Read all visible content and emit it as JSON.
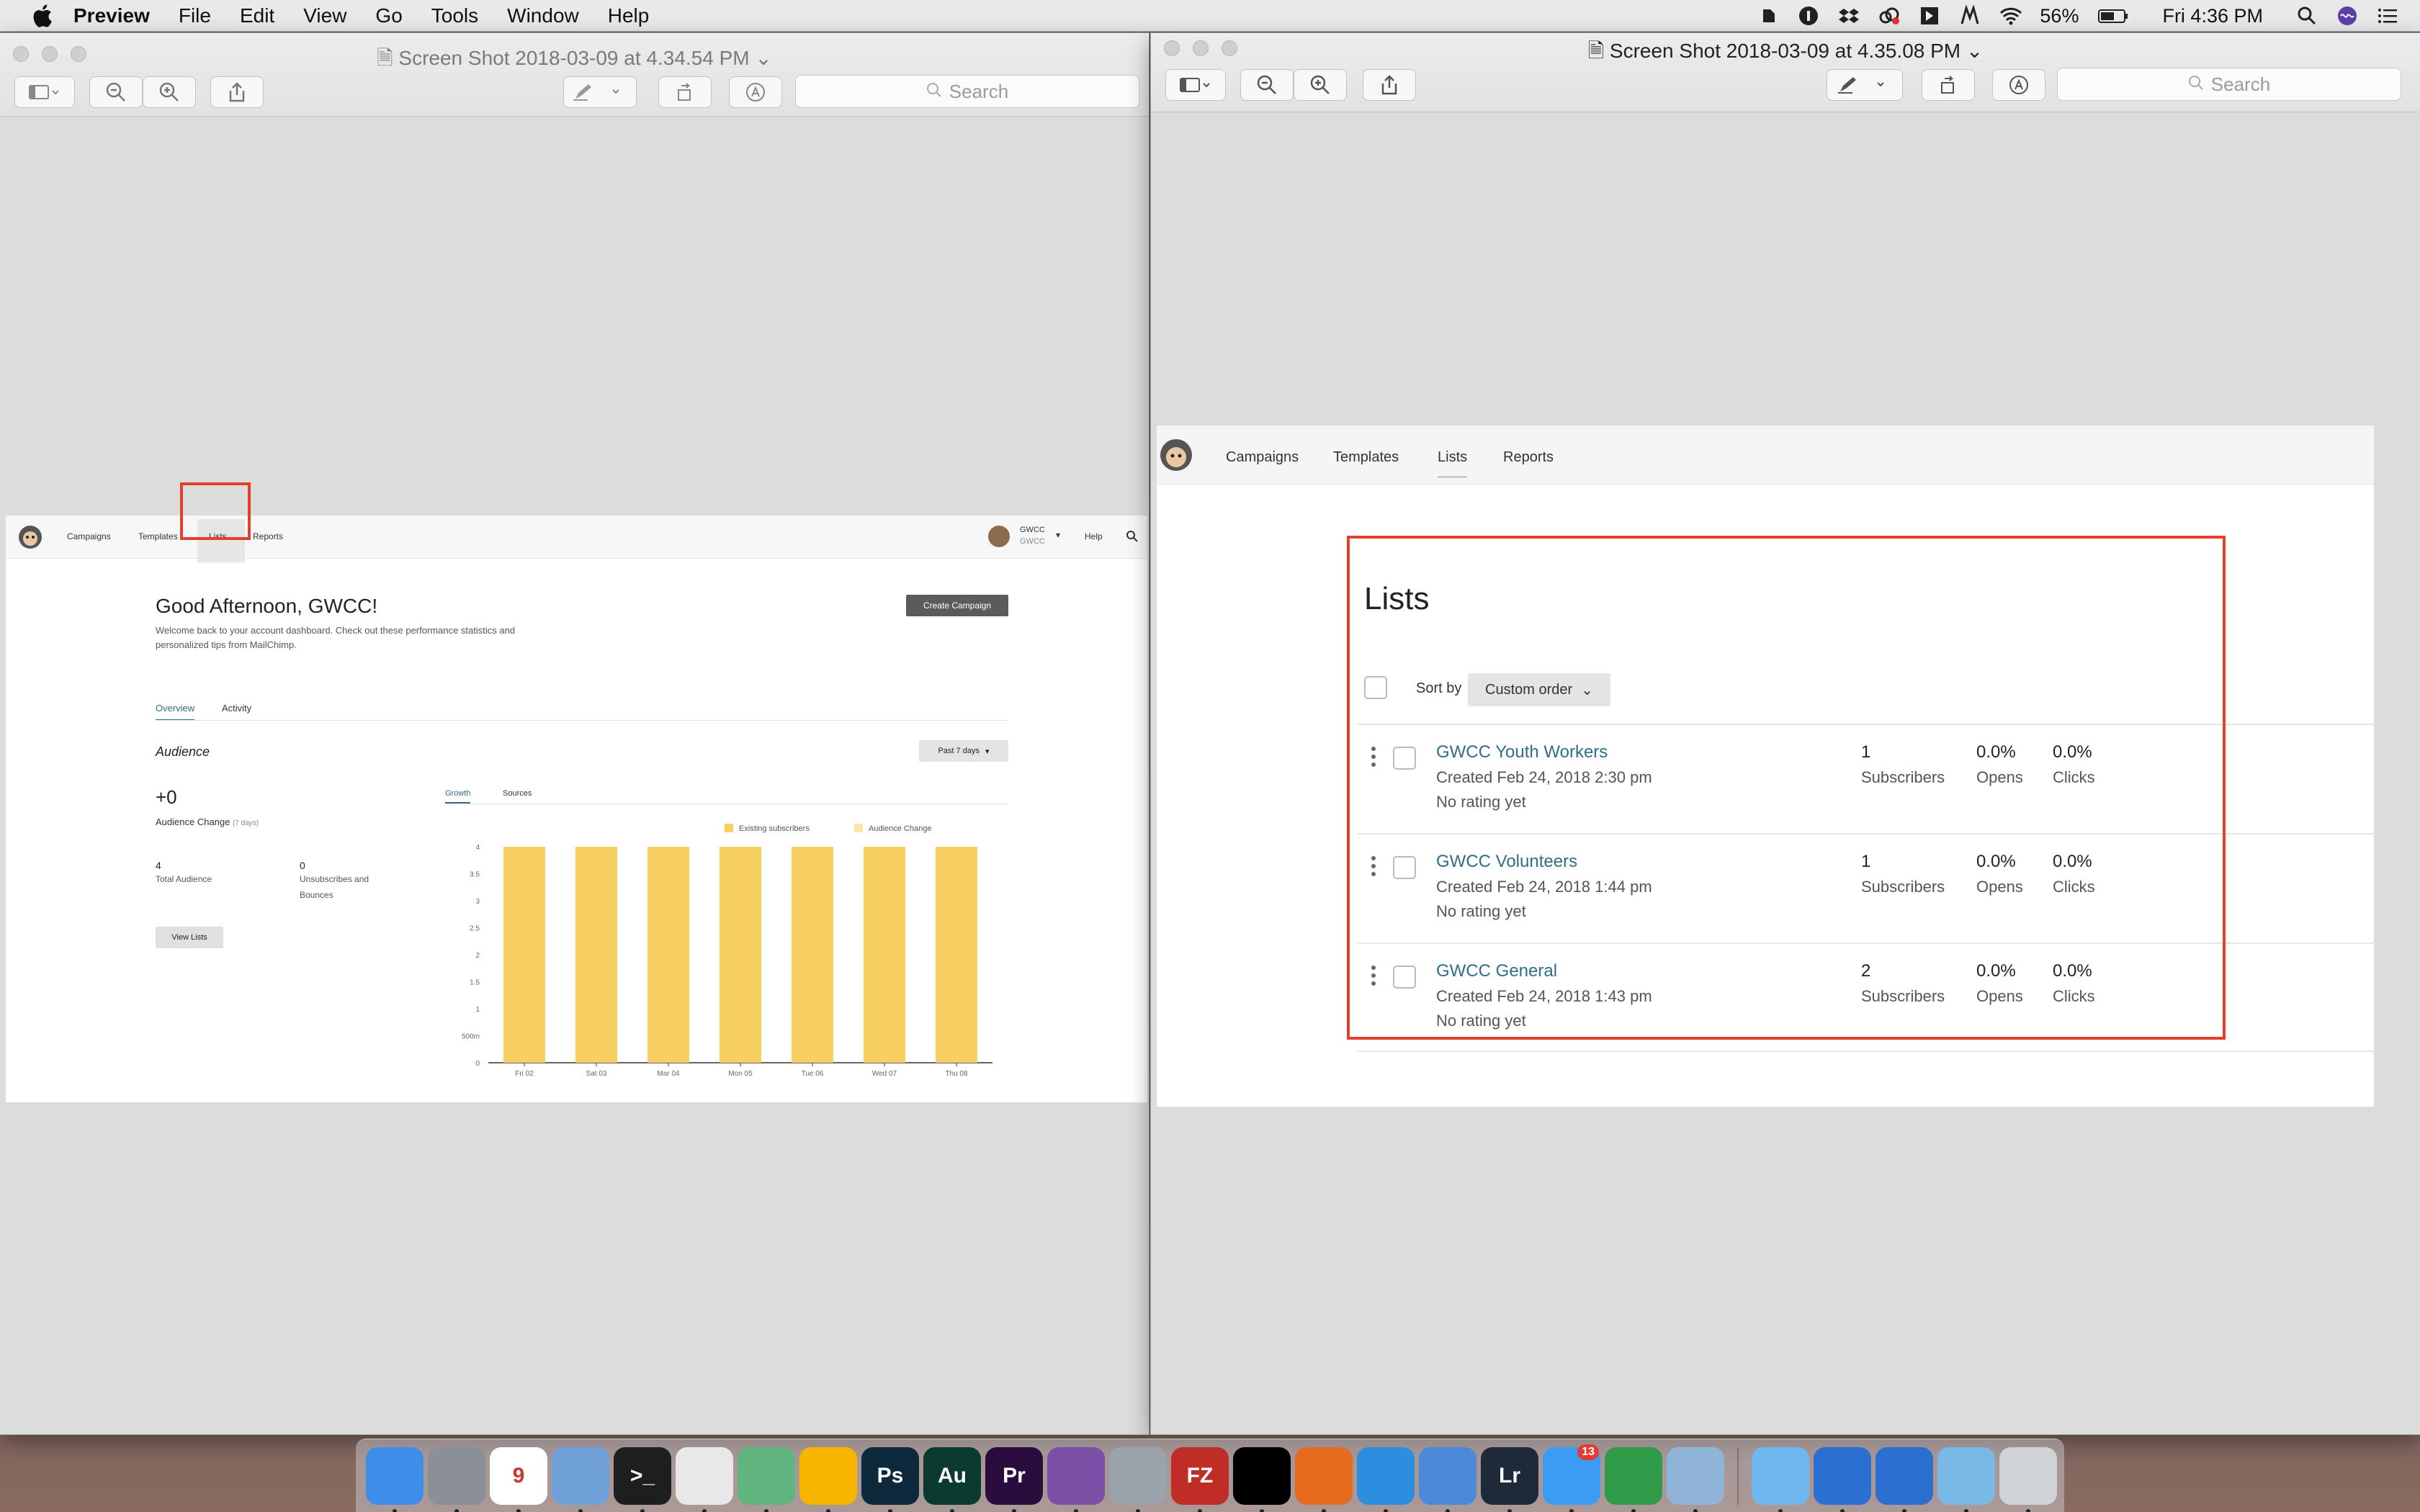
{
  "menubar": {
    "app": "Preview",
    "menus": [
      "File",
      "Edit",
      "View",
      "Go",
      "Tools",
      "Window",
      "Help"
    ],
    "battery": "56%",
    "clock": "Fri 4:36 PM"
  },
  "left_window": {
    "title": "Screen Shot 2018-03-09 at 4.34.54 PM",
    "search_placeholder": "Search",
    "doc": {
      "nav": [
        "Campaigns",
        "Templates",
        "Lists",
        "Reports"
      ],
      "account_name": "GWCC",
      "account_sub": "GWCC",
      "help": "Help",
      "greeting": "Good Afternoon, GWCC!",
      "welcome_line1": "Welcome back to your account dashboard. Check out these performance statistics and",
      "welcome_line2": "personalized tips from MailChimp.",
      "create_campaign": "Create Campaign",
      "tabs": [
        "Overview",
        "Activity"
      ],
      "audience_heading": "Audience",
      "range_select": "Past 7 days",
      "audience_change_value": "+0",
      "audience_change_label": "Audience Change",
      "audience_change_period": "(7 days)",
      "total_audience_value": "4",
      "total_audience_label": "Total Audience",
      "unsubs_value": "0",
      "unsubs_label1": "Unsubscribes and",
      "unsubs_label2": "Bounces",
      "view_lists": "View Lists",
      "chart_tabs": [
        "Growth",
        "Sources"
      ]
    }
  },
  "chart_data": {
    "type": "bar",
    "categories": [
      "Fri 02",
      "Sat 03",
      "Mar 04",
      "Mon 05",
      "Tue 06",
      "Wed 07",
      "Thu 08"
    ],
    "series": [
      {
        "name": "Existing subscribers",
        "values": [
          4,
          4,
          4,
          4,
          4,
          4,
          4
        ],
        "color": "#f8d061"
      },
      {
        "name": "Audience Change",
        "values": [
          0,
          0,
          0,
          0,
          0,
          0,
          0
        ],
        "color": "#fbe7a8"
      }
    ],
    "yticks": [
      "4",
      "3.5",
      "3",
      "2.5",
      "2",
      "1.5",
      "1",
      "500m",
      "0"
    ],
    "ylim": [
      0,
      4
    ],
    "grid": false,
    "legend": "top-right"
  },
  "right_window": {
    "title": "Screen Shot 2018-03-09 at 4.35.08 PM",
    "search_placeholder": "Search",
    "doc": {
      "nav": [
        "Campaigns",
        "Templates",
        "Lists",
        "Reports"
      ],
      "heading": "Lists",
      "sort_label": "Sort by",
      "sort_value": "Custom order",
      "lists": [
        {
          "name": "GWCC Youth Workers",
          "created": "Created Feb 24, 2018 2:30 pm",
          "rating": "No rating yet",
          "subscribers": "1",
          "subscribers_label": "Subscribers",
          "opens": "0.0%",
          "opens_label": "Opens",
          "clicks": "0.0%",
          "clicks_label": "Clicks"
        },
        {
          "name": "GWCC Volunteers",
          "created": "Created Feb 24, 2018 1:44 pm",
          "rating": "No rating yet",
          "subscribers": "1",
          "subscribers_label": "Subscribers",
          "opens": "0.0%",
          "opens_label": "Opens",
          "clicks": "0.0%",
          "clicks_label": "Clicks"
        },
        {
          "name": "GWCC General",
          "created": "Created Feb 24, 2018 1:43 pm",
          "rating": "No rating yet",
          "subscribers": "2",
          "subscribers_label": "Subscribers",
          "opens": "0.0%",
          "opens_label": "Opens",
          "clicks": "0.0%",
          "clicks_label": "Clicks"
        }
      ]
    }
  },
  "dock": {
    "apps": [
      {
        "icon": "finder-icon",
        "label": "",
        "color": "#3d8ee8"
      },
      {
        "icon": "launchpad-icon",
        "label": "",
        "color": "#8a8f98"
      },
      {
        "icon": "calendar-icon",
        "label": "9",
        "color": "#ffffff"
      },
      {
        "icon": "mail-icon",
        "label": "",
        "color": "#6fa0d8"
      },
      {
        "icon": "terminal-icon",
        "label": ">_",
        "color": "#1e1e1e"
      },
      {
        "icon": "chrome-icon",
        "label": "",
        "color": "#e8e8e8"
      },
      {
        "icon": "atom-icon",
        "label": "",
        "color": "#5fb57d"
      },
      {
        "icon": "sketch-icon",
        "label": "",
        "color": "#f7b500"
      },
      {
        "icon": "photoshop-icon",
        "label": "Ps",
        "color": "#0c2a3c"
      },
      {
        "icon": "audition-icon",
        "label": "Au",
        "color": "#0b3a2e"
      },
      {
        "icon": "premiere-icon",
        "label": "Pr",
        "color": "#2a0d3c"
      },
      {
        "icon": "github-icon",
        "label": "",
        "color": "#7b4fa5"
      },
      {
        "icon": "disk-utility-icon",
        "label": "",
        "color": "#9aa3ab"
      },
      {
        "icon": "filezilla-icon",
        "label": "FZ",
        "color": "#bf2d26"
      },
      {
        "icon": "tidal-icon",
        "label": "",
        "color": "#000000"
      },
      {
        "icon": "firefox-icon",
        "label": "",
        "color": "#e66b1f"
      },
      {
        "icon": "safari-icon",
        "label": "",
        "color": "#2d8ee0"
      },
      {
        "icon": "xcode-icon",
        "label": "",
        "color": "#4b8ad8"
      },
      {
        "icon": "lightroom-icon",
        "label": "Lr",
        "color": "#1e2a3a"
      },
      {
        "icon": "messages-icon",
        "label": "",
        "color": "#3b9cf4",
        "badge": "13"
      },
      {
        "icon": "evernote-icon",
        "label": "",
        "color": "#2f9a48"
      },
      {
        "icon": "preview-icon",
        "label": "",
        "color": "#8fb4d8"
      },
      {
        "icon": "folder-icon",
        "label": "",
        "color": "#6fb7ef"
      },
      {
        "icon": "globe-icon",
        "label": "",
        "color": "#2b6fd0"
      },
      {
        "icon": "network-icon",
        "label": "",
        "color": "#2b6fd0"
      },
      {
        "icon": "documents-folder-icon",
        "label": "",
        "color": "#7ab8e6"
      },
      {
        "icon": "trash-icon",
        "label": "",
        "color": "#d0d3d6"
      }
    ]
  }
}
